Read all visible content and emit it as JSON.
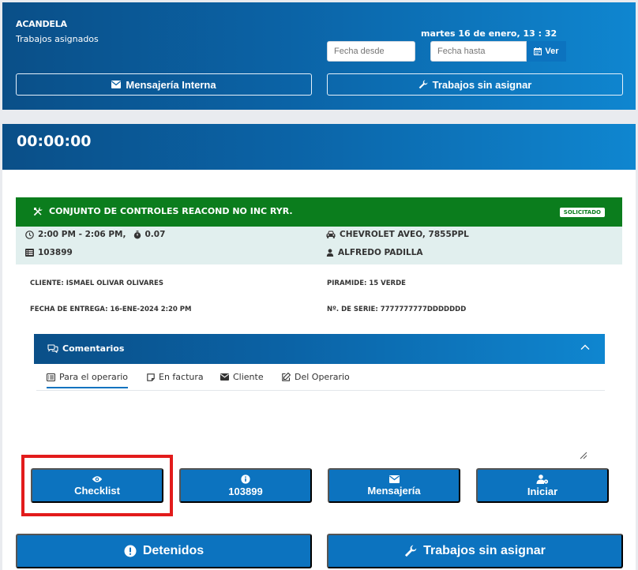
{
  "header": {
    "brand": "ACANDELA",
    "subtitle": "Trabajos asignados",
    "datetime": "martes 16 de enero, 13 : 32",
    "date_from_placeholder": "Fecha desde",
    "date_to_placeholder": "Fecha hasta",
    "view_label": "Ver",
    "internal_messages_label": "Mensajería Interna",
    "unassigned_jobs_label": "Trabajos sin asignar"
  },
  "timer": "00:00:00",
  "job": {
    "title": "CONJUNTO DE CONTROLES REACOND NO INC RYR.",
    "status": "SOLICITADO",
    "time_range": "2:00 PM - 2:06 PM,",
    "duration": "0.07",
    "order_number": "103899",
    "vehicle": "CHEVROLET AVEO, 7855PPL",
    "technician": "ALFREDO PADILLA"
  },
  "details": {
    "client": "CLIENTE: ISMAEL OLIVAR OLIVARES",
    "delivery": "FECHA DE ENTREGA: 16-ENE-2024 2:20 PM",
    "piramide": "PIRAMIDE: 15 VERDE",
    "serial": "Nº. DE SERIE: 7777777777DDDDDDD"
  },
  "comments": {
    "title": "Comentarios",
    "tabs": [
      "Para el operario",
      "En factura",
      "Cliente",
      "Del Operario"
    ]
  },
  "actions": {
    "checklist": "Checklist",
    "order": "103899",
    "messaging": "Mensajería",
    "start": "Iniciar"
  },
  "footer": {
    "stopped": "Detenidos",
    "unassigned": "Trabajos sin asignar"
  },
  "colors": {
    "primary": "#0c73bf",
    "header_gradient_start": "#0a4f88",
    "header_gradient_end": "#0f86d0",
    "job_header_green": "#0b7d1d",
    "info_bg": "#e1efee",
    "highlight_red": "#e21b1b"
  }
}
